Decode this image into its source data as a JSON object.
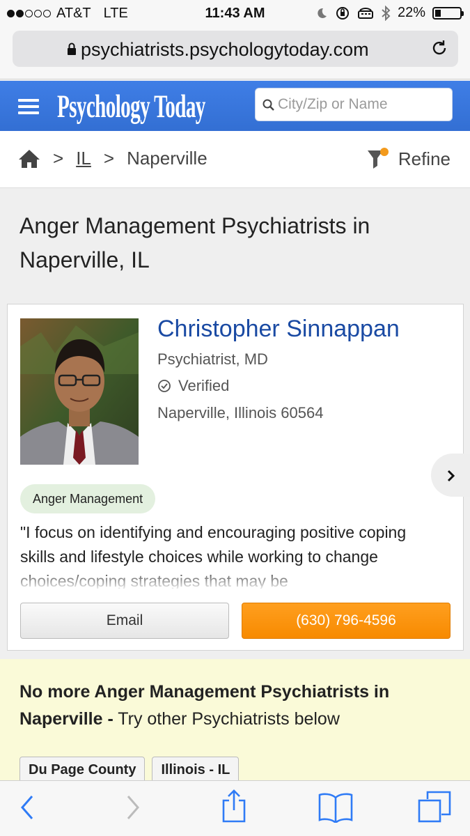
{
  "status_bar": {
    "carrier": "AT&T",
    "network": "LTE",
    "time": "11:43 AM",
    "battery": "22%",
    "battery_level": 0.22
  },
  "browser": {
    "url": "psychiatrists.psychologytoday.com"
  },
  "header": {
    "logo": "Psychology Today",
    "search_placeholder": "City/Zip or Name"
  },
  "breadcrumb": {
    "state": "IL",
    "city": "Naperville",
    "refine_label": "Refine"
  },
  "page": {
    "title": "Anger Management Psychiatrists in Naperville, IL"
  },
  "listing": {
    "name": "Christopher Sinnappan",
    "credentials": "Psychiatrist, MD",
    "verified_label": "Verified",
    "location": "Naperville, Illinois 60564",
    "tag": "Anger Management",
    "quote": "\"I focus on identifying and encouraging positive coping skills and lifestyle choices while working to change choices/coping strategies that may be",
    "email_label": "Email",
    "phone_label": "(630) 796-4596"
  },
  "no_more": {
    "bold_text": "No more Anger Management Psychiatrists in Naperville -",
    "rest_text": " Try other Psychiatrists below",
    "chips": [
      "Du Page County",
      "Illinois - IL"
    ]
  },
  "colors": {
    "header_blue": "#3a76db",
    "name_blue": "#1a4aa3",
    "phone_orange": "#f78a00",
    "tag_green": "#e3f0df",
    "nomore_bg": "#fafad8"
  }
}
